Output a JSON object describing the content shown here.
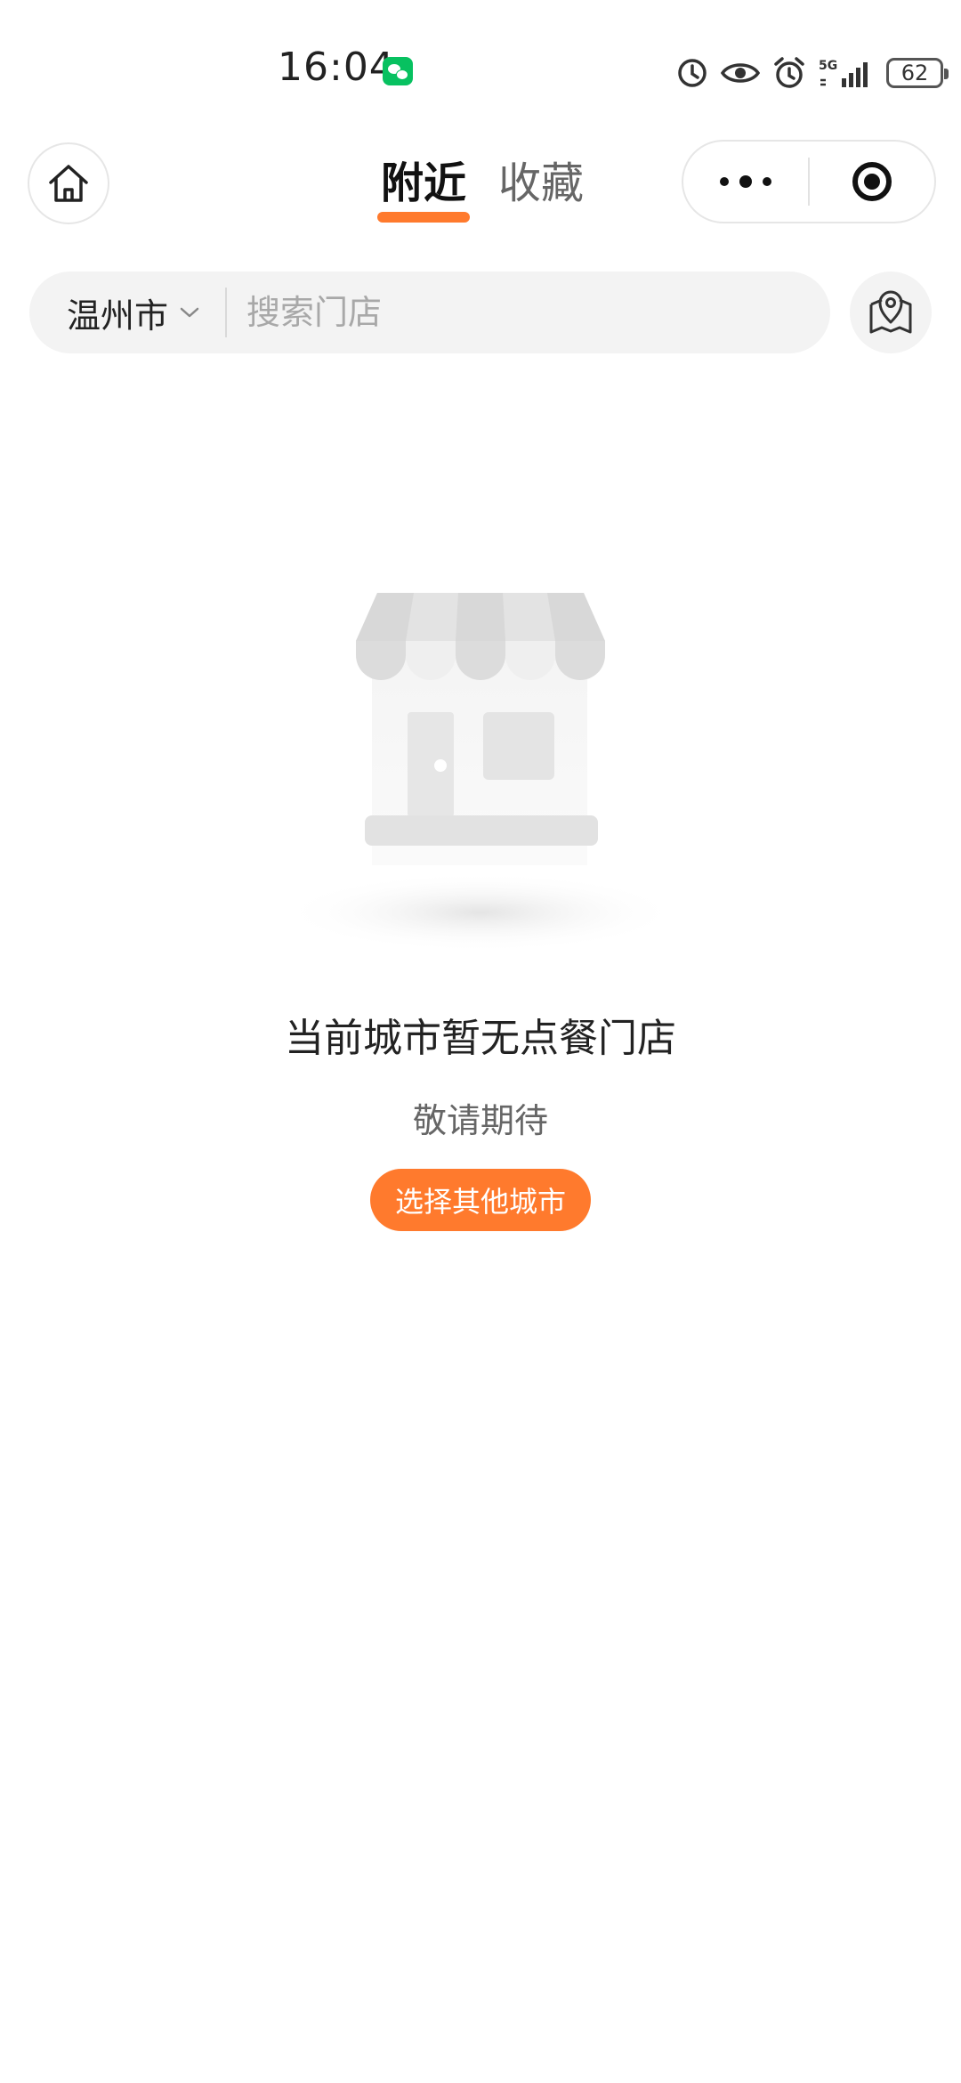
{
  "status_bar": {
    "time": "16:04",
    "battery": "62",
    "icons": [
      "wechat-notification-icon",
      "data-saver-icon",
      "eye-icon",
      "alarm-icon",
      "5g-signal-icon",
      "battery-icon"
    ]
  },
  "nav": {
    "tabs": [
      {
        "label": "附近",
        "active": true
      },
      {
        "label": "收藏",
        "active": false
      }
    ],
    "icons": [
      "home-icon",
      "more-dots-icon",
      "target-icon"
    ]
  },
  "search": {
    "city": "温州市",
    "placeholder": "搜索门店",
    "map_icon": "map-pin-icon"
  },
  "empty_state": {
    "illustration": "store-icon",
    "title": "当前城市暂无点餐门店",
    "subtitle": "敬请期待",
    "button_label": "选择其他城市"
  },
  "colors": {
    "accent": "#ff7a2d",
    "background": "#ffffff",
    "search_background": "#f3f3f3",
    "wechat_green": "#07c160"
  }
}
